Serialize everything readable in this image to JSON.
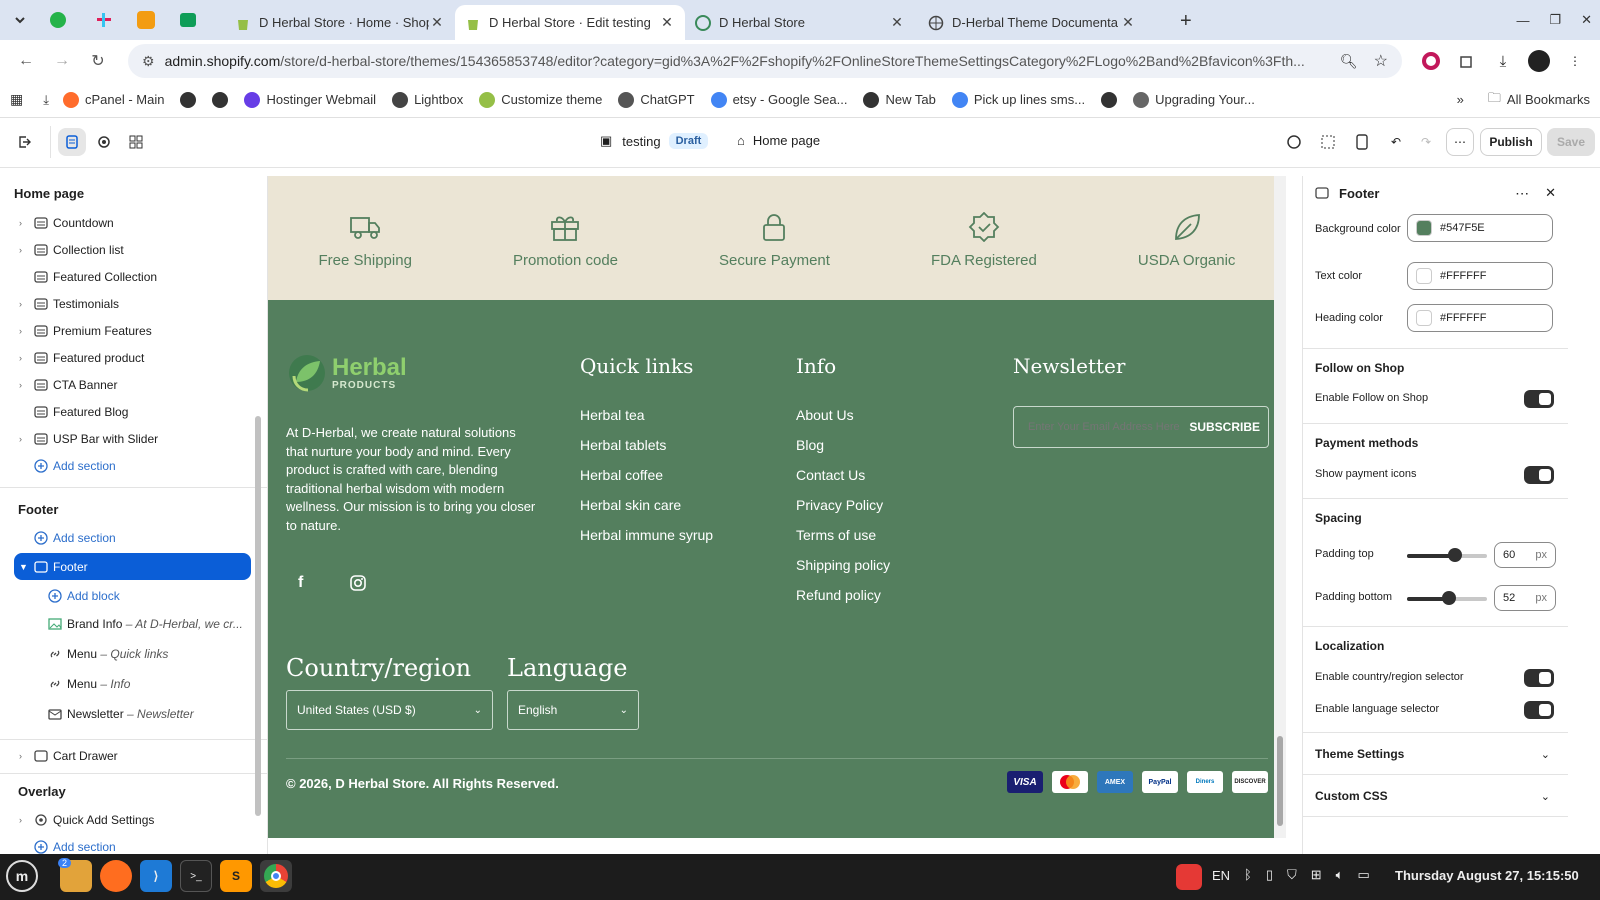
{
  "browser": {
    "tabs": [
      {
        "title": "D Herbal Store · Home · Shop",
        "favicon": "shopify-icon"
      },
      {
        "title": "D Herbal Store · Edit testing",
        "favicon": "shopify-icon",
        "active": true
      },
      {
        "title": "D Herbal Store",
        "favicon": "leaf-icon"
      },
      {
        "title": "D-Herbal Theme Documenta",
        "favicon": "globe-icon"
      }
    ],
    "url_main": "admin.shopify.com",
    "url_rest": "/store/d-herbal-store/themes/154365853748/editor?category=gid%3A%2F%2Fshopify%2FOnlineStoreThemeSettingsCategory%2FLogo%2Band%2Bfavicon%3Fth...",
    "bookmarks": [
      {
        "label": "cPanel - Main",
        "color": "#ff6c2c"
      },
      {
        "label": "",
        "color": "#333"
      },
      {
        "label": "",
        "color": "#333"
      },
      {
        "label": "Hostinger Webmail",
        "color": "#673de6"
      },
      {
        "label": "Lightbox",
        "color": "#444"
      },
      {
        "label": "Customize theme",
        "color": "#95bf47"
      },
      {
        "label": "ChatGPT",
        "color": "#555"
      },
      {
        "label": "etsy - Google Sea...",
        "color": "#4285f4"
      },
      {
        "label": "New Tab",
        "color": "#333"
      },
      {
        "label": "Pick up lines sms...",
        "color": "#4285f4"
      },
      {
        "label": "",
        "color": "#333"
      },
      {
        "label": "Upgrading Your...",
        "color": "#666"
      }
    ],
    "all_bookmarks": "All Bookmarks"
  },
  "editor": {
    "theme_name": "testing",
    "theme_status": "Draft",
    "page": "Home page",
    "publish": "Publish",
    "save": "Save"
  },
  "left_panel": {
    "title": "Home page",
    "sections": [
      {
        "label": "Countdown",
        "chev": true
      },
      {
        "label": "Collection list",
        "chev": true
      },
      {
        "label": "Featured Collection",
        "chev": false
      },
      {
        "label": "Testimonials",
        "chev": true
      },
      {
        "label": "Premium Features",
        "chev": true
      },
      {
        "label": "Featured product",
        "chev": true
      },
      {
        "label": "CTA Banner",
        "chev": true
      },
      {
        "label": "Featured Blog",
        "chev": false
      },
      {
        "label": "USP Bar with Slider",
        "chev": true
      }
    ],
    "add_section": "Add section",
    "footer_group": "Footer",
    "footer_item": "Footer",
    "add_block": "Add block",
    "blocks": [
      {
        "label": "Brand Info",
        "detail": "– At D-Herbal, we cr..."
      },
      {
        "label": "Menu",
        "detail": "– Quick links"
      },
      {
        "label": "Menu",
        "detail": "– Info"
      },
      {
        "label": "Newsletter",
        "detail": "– Newsletter"
      }
    ],
    "cart_drawer": "Cart Drawer",
    "overlay_group": "Overlay",
    "quick_add": "Quick Add Settings"
  },
  "preview": {
    "usp": [
      "Free Shipping",
      "Promotion code",
      "Secure Payment",
      "FDA Registered",
      "USDA Organic"
    ],
    "logo_main": "Herbal",
    "logo_sub": "PRODUCTS",
    "brand_text": "At D-Herbal, we create natural solutions that nurture your body and mind. Every product is crafted with care, blending traditional herbal wisdom with modern wellness. Our mission is to bring you closer to nature.",
    "quick_links_title": "Quick links",
    "quick_links": [
      "Herbal tea",
      "Herbal tablets",
      "Herbal coffee",
      "Herbal skin care",
      "Herbal immune syrup"
    ],
    "info_title": "Info",
    "info_links": [
      "About Us",
      "Blog",
      "Contact Us",
      "Privacy Policy",
      "Terms of use",
      "Shipping policy",
      "Refund policy"
    ],
    "newsletter_title": "Newsletter",
    "email_placeholder": "Enter Your Email Address Here",
    "subscribe": "SUBSCRIBE",
    "country_title": "Country/region",
    "country_value": "United States (USD $)",
    "language_title": "Language",
    "language_value": "English",
    "copyright": "© 2026, D Herbal Store. All Rights Reserved.",
    "payments": [
      "VISA",
      "MC",
      "AMEX",
      "PayPal",
      "Diners",
      "DISCOVER"
    ]
  },
  "right_panel": {
    "title": "Footer",
    "bg_label": "Background color",
    "bg_value": "#547F5E",
    "text_label": "Text color",
    "text_value": "#FFFFFF",
    "heading_label": "Heading color",
    "heading_value": "#FFFFFF",
    "follow_title": "Follow on Shop",
    "follow_label": "Enable Follow on Shop",
    "payment_title": "Payment methods",
    "payment_label": "Show payment icons",
    "spacing_title": "Spacing",
    "padding_top_label": "Padding top",
    "padding_top": "60",
    "padding_top_level": 0.6,
    "padding_bottom_label": "Padding bottom",
    "padding_bottom": "52",
    "padding_bottom_level": 0.52,
    "unit": "px",
    "localization_title": "Localization",
    "country_selector_label": "Enable country/region selector",
    "language_selector_label": "Enable language selector",
    "theme_settings": "Theme Settings",
    "custom_css": "Custom CSS"
  },
  "taskbar": {
    "lang": "EN",
    "clock": "Thursday August 27, 15:15:50",
    "badge": "2"
  },
  "colors": {
    "footer_bg": "#547F5E",
    "usp_bg": "#ebe5d5",
    "accent": "#0b5ed7"
  }
}
